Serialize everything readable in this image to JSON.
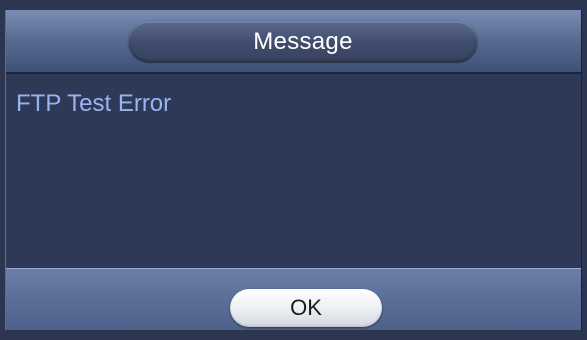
{
  "dialog": {
    "title": "Message",
    "message": "FTP Test Error",
    "ok_label": "OK"
  },
  "colors": {
    "background": "#2e3957",
    "message_text": "#9ab3f0",
    "title_text": "#ffffff"
  }
}
